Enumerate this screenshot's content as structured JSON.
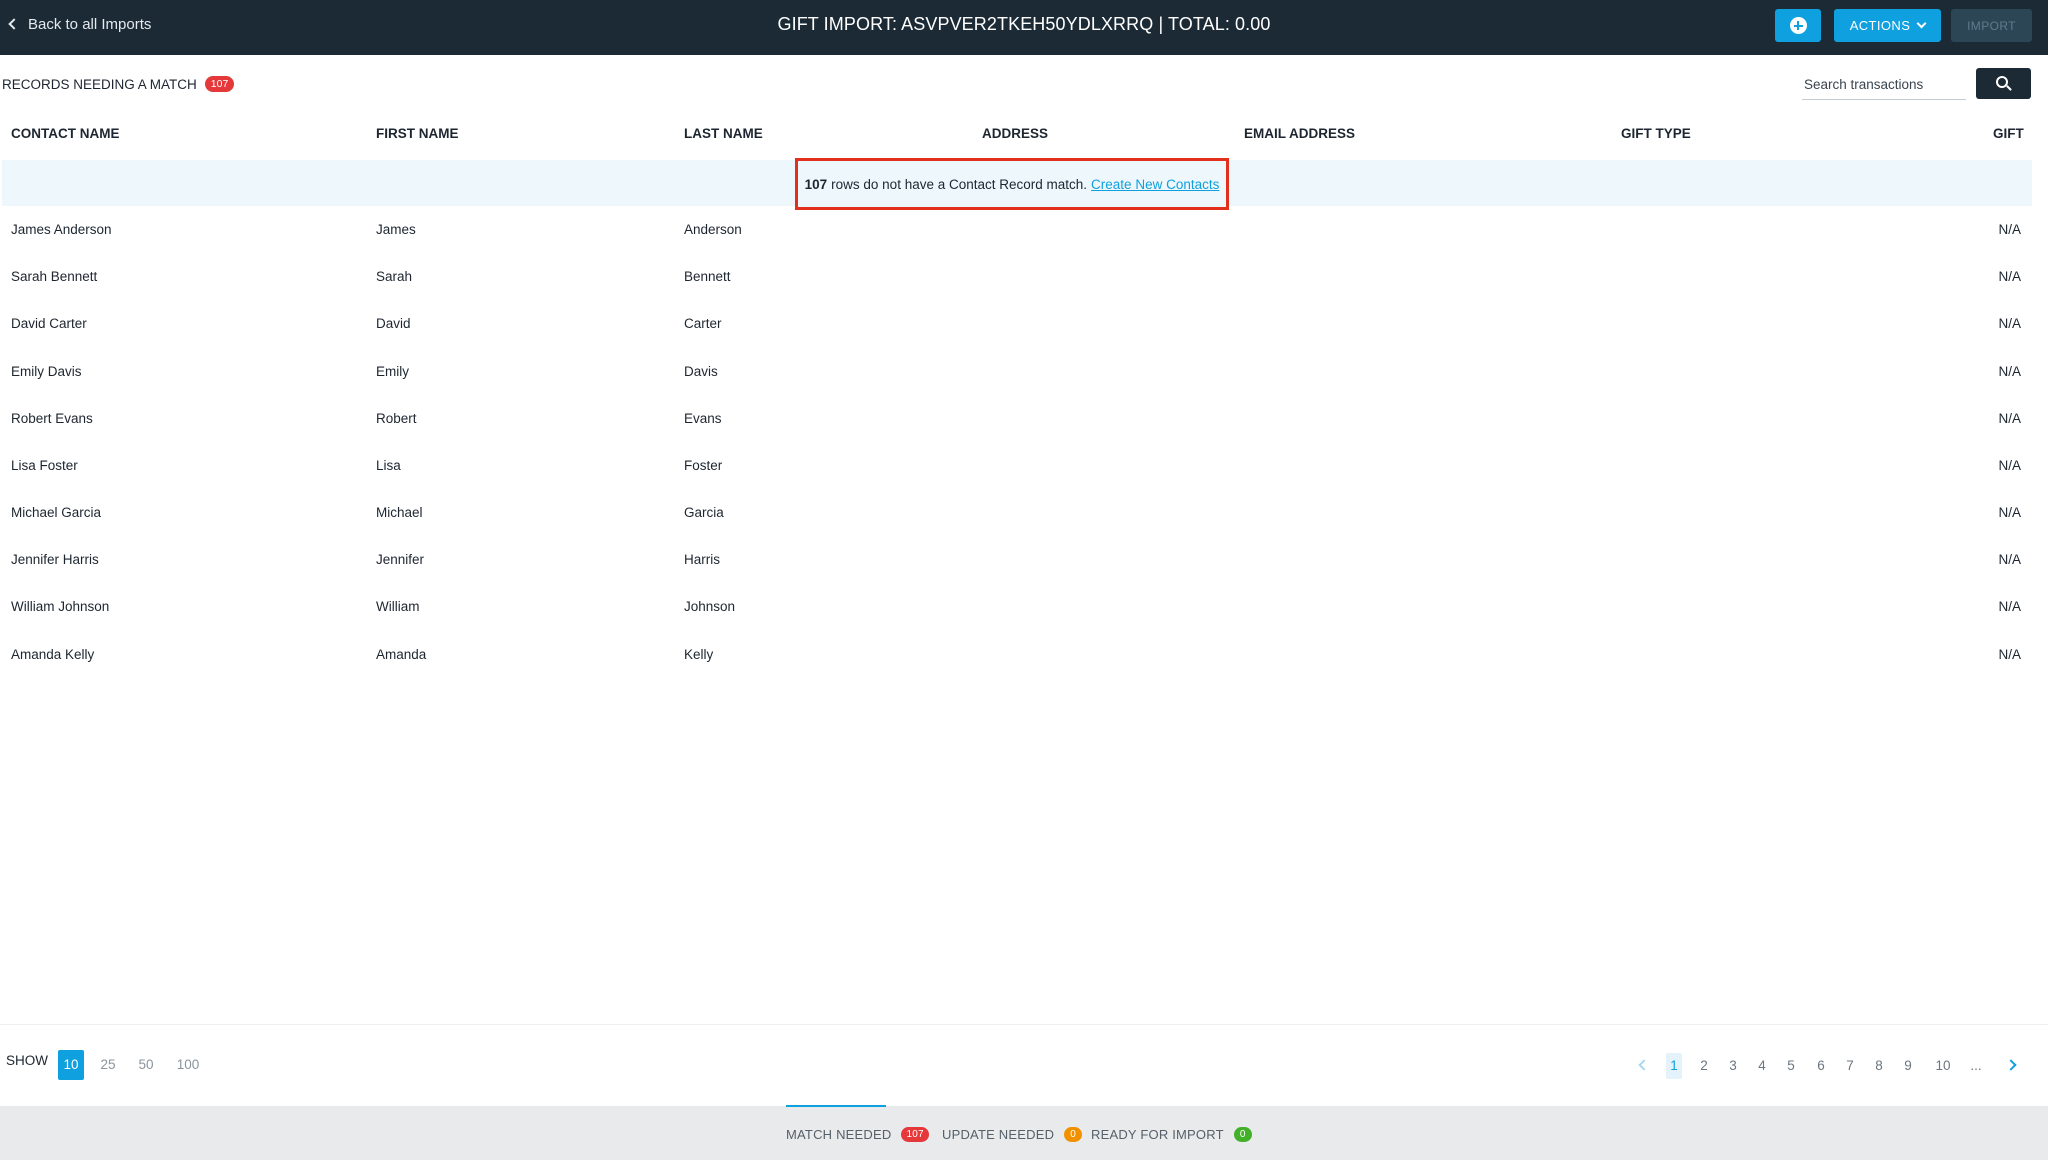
{
  "header": {
    "back_label": "Back to all Imports",
    "title": "GIFT IMPORT: ASVPVER2TKEH50YDLXRRQ | TOTAL: 0.00",
    "actions_label": "ACTIONS",
    "import_label": "IMPORT"
  },
  "section": {
    "title": "RECORDS NEEDING A MATCH",
    "count": "107",
    "search_placeholder": "Search transactions"
  },
  "table": {
    "headers": {
      "contact_name": "CONTACT NAME",
      "first_name": "FIRST NAME",
      "last_name": "LAST NAME",
      "address": "ADDRESS",
      "email": "EMAIL ADDRESS",
      "gift_type": "GIFT TYPE",
      "gift": "GIFT"
    },
    "notice": {
      "count": "107",
      "text": "rows do not have a Contact Record match.",
      "link": "Create New Contacts"
    },
    "rows": [
      {
        "contact_name": "James Anderson",
        "first_name": "James",
        "last_name": "Anderson",
        "gift": "N/A"
      },
      {
        "contact_name": "Sarah Bennett",
        "first_name": "Sarah",
        "last_name": "Bennett",
        "gift": "N/A"
      },
      {
        "contact_name": "David Carter",
        "first_name": "David",
        "last_name": "Carter",
        "gift": "N/A"
      },
      {
        "contact_name": "Emily Davis",
        "first_name": "Emily",
        "last_name": "Davis",
        "gift": "N/A"
      },
      {
        "contact_name": "Robert Evans",
        "first_name": "Robert",
        "last_name": "Evans",
        "gift": "N/A"
      },
      {
        "contact_name": "Lisa Foster",
        "first_name": "Lisa",
        "last_name": "Foster",
        "gift": "N/A"
      },
      {
        "contact_name": "Michael Garcia",
        "first_name": "Michael",
        "last_name": "Garcia",
        "gift": "N/A"
      },
      {
        "contact_name": "Jennifer Harris",
        "first_name": "Jennifer",
        "last_name": "Harris",
        "gift": "N/A"
      },
      {
        "contact_name": "William Johnson",
        "first_name": "William",
        "last_name": "Johnson",
        "gift": "N/A"
      },
      {
        "contact_name": "Amanda Kelly",
        "first_name": "Amanda",
        "last_name": "Kelly",
        "gift": "N/A"
      }
    ]
  },
  "pager": {
    "show_label": "SHOW",
    "page_sizes": [
      "10",
      "25",
      "50",
      "100"
    ],
    "active_page_size": "10",
    "pages": [
      "1",
      "2",
      "3",
      "4",
      "5",
      "6",
      "7",
      "8",
      "9",
      "10",
      "..."
    ],
    "active_page": "1"
  },
  "tabs": [
    {
      "label": "MATCH NEEDED",
      "count": "107",
      "color": "#e5383b"
    },
    {
      "label": "UPDATE NEEDED",
      "count": "0",
      "color": "#f29100"
    },
    {
      "label": "READY FOR IMPORT",
      "count": "0",
      "color": "#43b02a"
    }
  ],
  "colors": {
    "topbar": "#1b2a35",
    "accent": "#0fa0df",
    "highlight_border": "#e3301d"
  },
  "icons": {
    "back": "chevron-left-icon",
    "add": "plus-circle-icon",
    "actions_caret": "chevron-down-icon",
    "search": "search-icon",
    "prev": "chevron-left-icon",
    "next": "chevron-right-icon"
  }
}
